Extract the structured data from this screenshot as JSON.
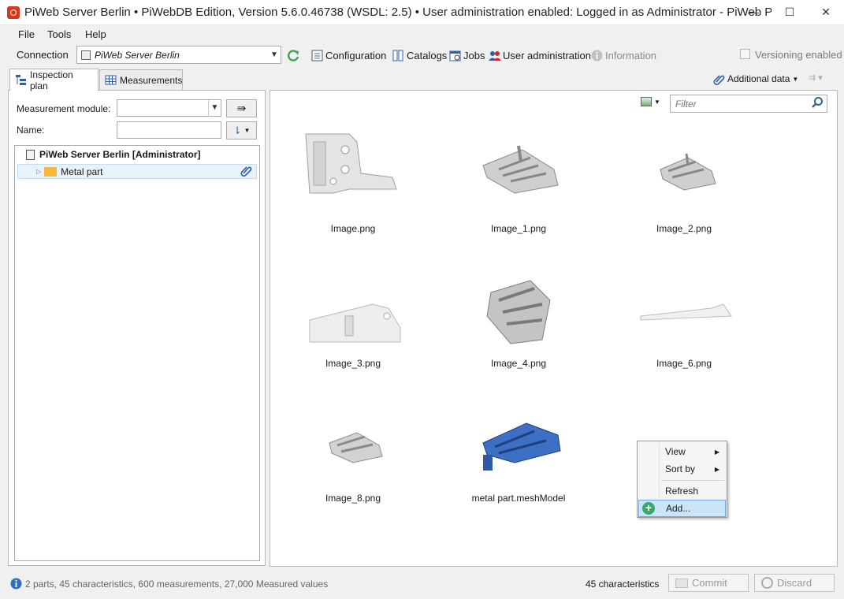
{
  "window": {
    "title": "PiWeb Server Berlin • PiWebDB Edition, Version 5.6.0.46738 (WSDL: 2.5) • User administration enabled: Logged in as Administrator - PiWeb P...",
    "minimize_glyph": "—",
    "maximize_glyph": "☐",
    "close_glyph": "✕"
  },
  "menu": {
    "file": "File",
    "tools": "Tools",
    "help": "Help"
  },
  "toolbar": {
    "connection_label": "Connection",
    "connection_value": "PiWeb Server Berlin",
    "configuration": "Configuration",
    "catalogs": "Catalogs",
    "jobs": "Jobs",
    "user_administration": "User administration",
    "information": "Information",
    "versioning": "Versioning enabled"
  },
  "tabs": {
    "inspection_plan": "Inspection plan",
    "measurements": "Measurements"
  },
  "left": {
    "measurement_module_label": "Measurement module:",
    "measurement_module_value": "",
    "name_label": "Name:",
    "name_value": "",
    "tree_root": "PiWeb Server Berlin [Administrator]",
    "tree_child": "Metal part"
  },
  "right": {
    "additional_data": "Additional data",
    "filter_placeholder": "Filter",
    "files": [
      {
        "name": "Image.png",
        "color": "#b8b8b8"
      },
      {
        "name": "Image_1.png",
        "color": "#9a9a9a"
      },
      {
        "name": "Image_2.png",
        "color": "#9a9a9a"
      },
      {
        "name": "Image_3.png",
        "color": "#c8c8c8"
      },
      {
        "name": "Image_4.png",
        "color": "#8e8e8e"
      },
      {
        "name": "Image_6.png",
        "color": "#d0d0d0"
      },
      {
        "name": "Image_8.png",
        "color": "#a0a0a0"
      },
      {
        "name": "metal part.meshModel",
        "color": "#3060b8"
      }
    ]
  },
  "context_menu": {
    "view": "View",
    "sort_by": "Sort by",
    "refresh": "Refresh",
    "add": "Add..."
  },
  "status": {
    "summary": "2 parts, 45 characteristics, 600 measurements, 27,000 Measured values",
    "characteristics": "45 characteristics",
    "commit": "Commit",
    "discard": "Discard"
  }
}
